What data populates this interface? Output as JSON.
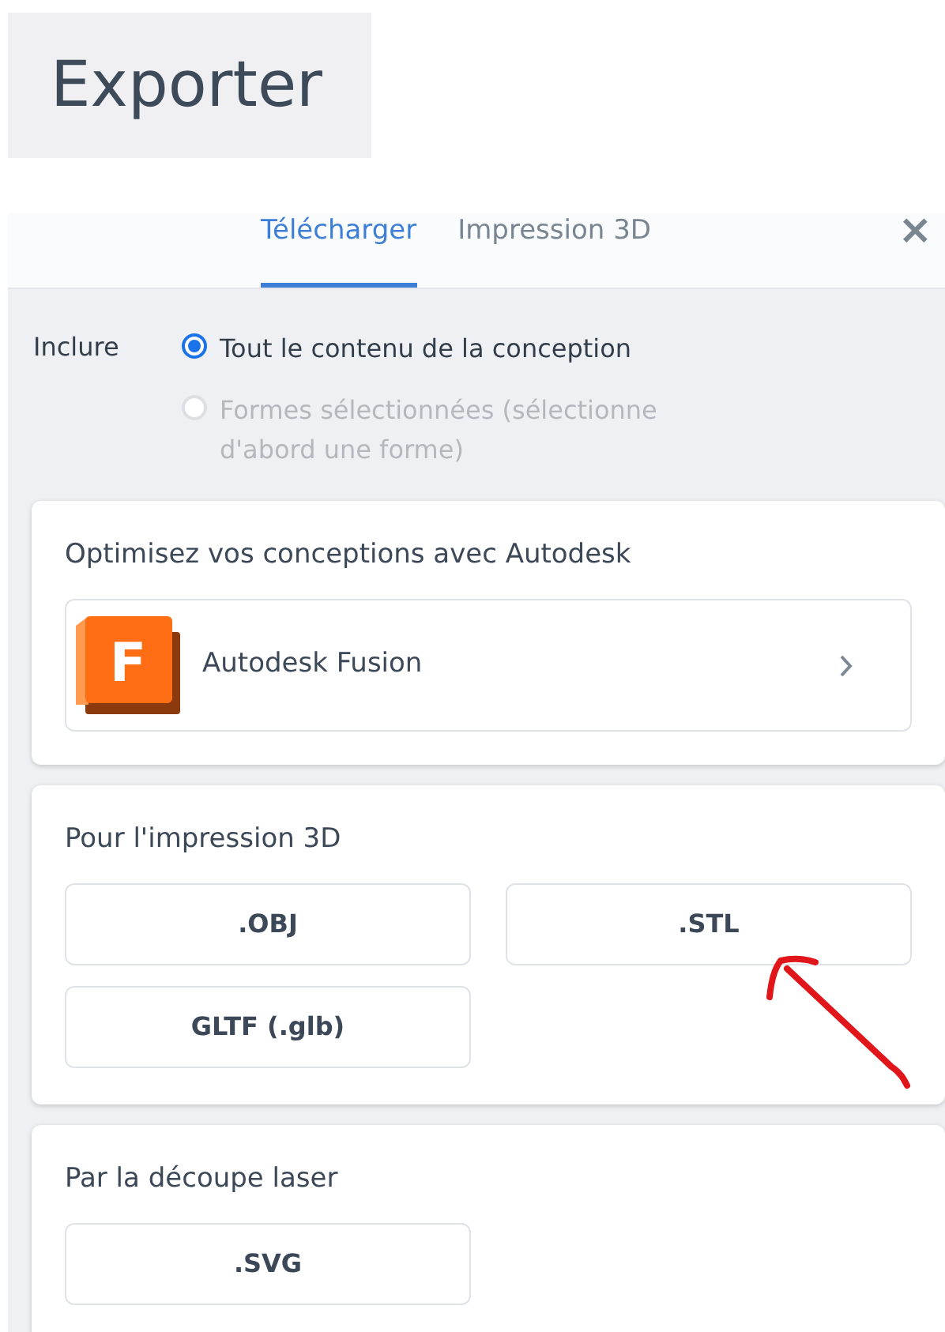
{
  "export_button": {
    "label": "Exporter"
  },
  "dialog": {
    "tabs": [
      {
        "label": "Télécharger",
        "selected": true
      },
      {
        "label": "Impression 3D",
        "selected": false
      }
    ],
    "close": "×",
    "include": {
      "label": "Inclure",
      "options": [
        {
          "label": "Tout le contenu de la conception",
          "selected": true,
          "disabled": false
        },
        {
          "label": "Formes sélectionnées (sélectionne d'abord une forme)",
          "selected": false,
          "disabled": true
        }
      ]
    },
    "sections": [
      {
        "kind": "app",
        "title": "Optimisez vos conceptions avec Autodesk",
        "app": {
          "label": "Autodesk Fusion",
          "logo_letter": "F"
        }
      },
      {
        "kind": "formats",
        "title": "Pour l'impression 3D",
        "buttons": [
          ".OBJ",
          ".STL",
          "GLTF (.glb)"
        ]
      },
      {
        "kind": "formats",
        "title": "Par la découpe laser",
        "buttons": [
          ".SVG"
        ]
      }
    ]
  }
}
